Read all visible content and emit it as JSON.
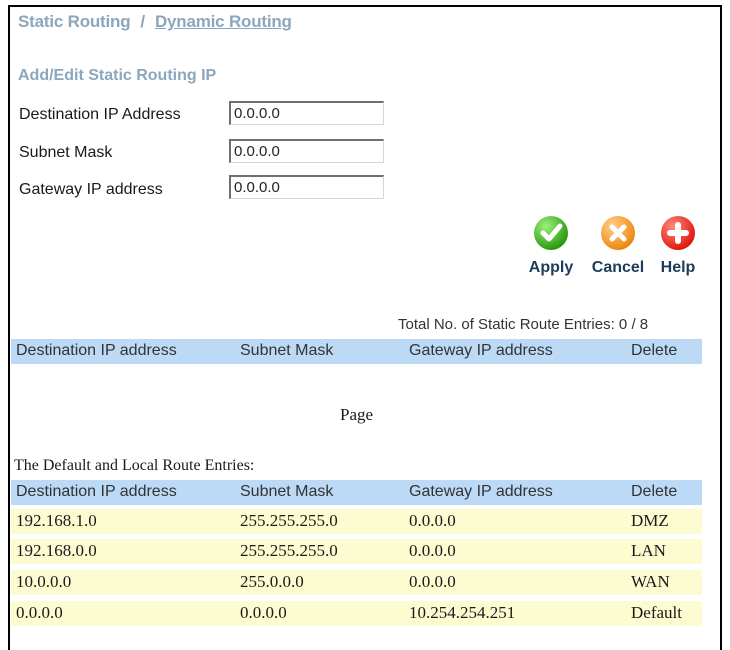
{
  "nav": {
    "static_routing": "Static Routing",
    "separator": "/",
    "dynamic_routing": "Dynamic Routing"
  },
  "form": {
    "title": "Add/Edit Static Routing IP",
    "fields": [
      {
        "label": "Destination IP Address",
        "value": "0.0.0.0"
      },
      {
        "label": "Subnet Mask",
        "value": "0.0.0.0"
      },
      {
        "label": "Gateway IP address",
        "value": "0.0.0.0"
      }
    ]
  },
  "buttons": {
    "apply": {
      "label": "Apply",
      "icon": "check-icon",
      "color": "#2f9e14"
    },
    "cancel": {
      "label": "Cancel",
      "icon": "x-icon",
      "color": "#f08b14"
    },
    "help": {
      "label": "Help",
      "icon": "plus-icon",
      "color": "#e21e14"
    }
  },
  "static_routes": {
    "total_label": "Total No. of Static Route Entries: 0 / 8",
    "columns": [
      "Destination IP address",
      "Subnet Mask",
      "Gateway IP address",
      "Delete"
    ],
    "rows": [],
    "page_label": "Page"
  },
  "default_routes": {
    "title": "The Default and Local Route Entries:",
    "columns": [
      "Destination IP address",
      "Subnet Mask",
      "Gateway IP address",
      "Delete"
    ],
    "rows": [
      [
        "192.168.1.0",
        "255.255.255.0",
        "0.0.0.0",
        "DMZ"
      ],
      [
        "192.168.0.0",
        "255.255.255.0",
        "0.0.0.0",
        "LAN"
      ],
      [
        "10.0.0.0",
        "255.0.0.0",
        "0.0.0.0",
        "WAN"
      ],
      [
        "0.0.0.0",
        "0.0.0.0",
        "10.254.254.251",
        "Default"
      ]
    ]
  },
  "colors": {
    "link": "#8ba7bd",
    "header_row": "#bcd9f5",
    "entry_row": "#fdfbd0",
    "button_caption": "#1d3b5c"
  }
}
